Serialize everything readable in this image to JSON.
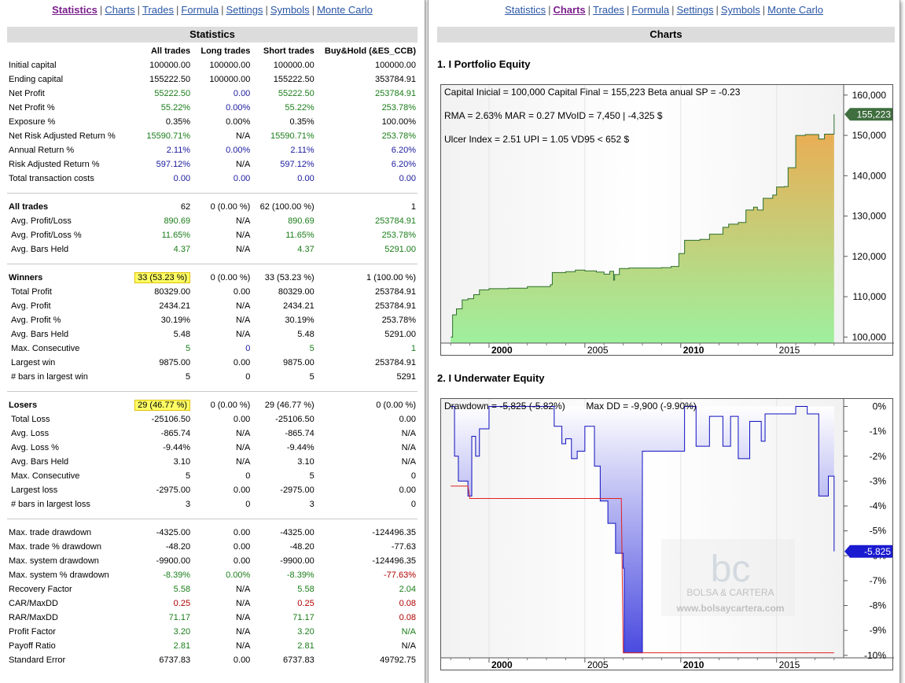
{
  "nav": {
    "items": [
      "Statistics",
      "Charts",
      "Trades",
      "Formula",
      "Settings",
      "Symbols",
      "Monte Carlo"
    ],
    "separator": "|"
  },
  "stats": {
    "title": "Statistics",
    "columns": [
      "All trades",
      "Long trades",
      "Short trades",
      "Buy&Hold (&ES_CCB)"
    ],
    "rows": [
      {
        "label": "Initial capital",
        "values": [
          "100000.00",
          "100000.00",
          "100000.00",
          "100000.00"
        ],
        "colors": [
          "",
          "",
          "",
          ""
        ]
      },
      {
        "label": "Ending capital",
        "values": [
          "155222.50",
          "100000.00",
          "155222.50",
          "353784.91"
        ],
        "colors": [
          "",
          "",
          "",
          ""
        ]
      },
      {
        "label": "Net Profit",
        "values": [
          "55222.50",
          "0.00",
          "55222.50",
          "253784.91"
        ],
        "colors": [
          "green",
          "blue",
          "green",
          "green"
        ]
      },
      {
        "label": "Net Profit %",
        "values": [
          "55.22%",
          "0.00%",
          "55.22%",
          "253.78%"
        ],
        "colors": [
          "green",
          "blue",
          "green",
          "green"
        ]
      },
      {
        "label": "Exposure %",
        "values": [
          "0.35%",
          "0.00%",
          "0.35%",
          "100.00%"
        ],
        "colors": [
          "",
          "",
          "",
          ""
        ]
      },
      {
        "label": "Net Risk Adjusted Return %",
        "values": [
          "15590.71%",
          "N/A",
          "15590.71%",
          "253.78%"
        ],
        "colors": [
          "green",
          "",
          "green",
          "green"
        ]
      },
      {
        "label": "Annual Return %",
        "values": [
          "2.11%",
          "0.00%",
          "2.11%",
          "6.20%"
        ],
        "colors": [
          "blue",
          "blue",
          "blue",
          "blue"
        ]
      },
      {
        "label": "Risk Adjusted Return %",
        "values": [
          "597.12%",
          "N/A",
          "597.12%",
          "6.20%"
        ],
        "colors": [
          "blue",
          "",
          "blue",
          "blue"
        ]
      },
      {
        "label": "Total transaction costs",
        "values": [
          "0.00",
          "0.00",
          "0.00",
          "0.00"
        ],
        "colors": [
          "blue",
          "blue",
          "blue",
          "blue"
        ]
      },
      {
        "separator": true
      },
      {
        "label": "All trades",
        "bold": true,
        "values": [
          "62",
          "0 (0.00 %)",
          "62 (100.00 %)",
          "1"
        ],
        "colors": [
          "",
          "",
          "",
          ""
        ]
      },
      {
        "label": "Avg. Profit/Loss",
        "sub": true,
        "values": [
          "890.69",
          "N/A",
          "890.69",
          "253784.91"
        ],
        "colors": [
          "green",
          "",
          "green",
          "green"
        ]
      },
      {
        "label": "Avg. Profit/Loss %",
        "sub": true,
        "values": [
          "11.65%",
          "N/A",
          "11.65%",
          "253.78%"
        ],
        "colors": [
          "green",
          "",
          "green",
          "green"
        ]
      },
      {
        "label": "Avg. Bars Held",
        "sub": true,
        "values": [
          "4.37",
          "N/A",
          "4.37",
          "5291.00"
        ],
        "colors": [
          "green",
          "",
          "green",
          "green"
        ]
      },
      {
        "separator": true
      },
      {
        "label": "Winners",
        "bold": true,
        "highlight": true,
        "values": [
          "33 (53.23 %)",
          "0 (0.00 %)",
          "33 (53.23 %)",
          "1 (100.00 %)"
        ],
        "colors": [
          "",
          "",
          "",
          ""
        ]
      },
      {
        "label": "Total Profit",
        "sub": true,
        "values": [
          "80329.00",
          "0.00",
          "80329.00",
          "253784.91"
        ],
        "colors": [
          "",
          "",
          "",
          ""
        ]
      },
      {
        "label": "Avg. Profit",
        "sub": true,
        "values": [
          "2434.21",
          "N/A",
          "2434.21",
          "253784.91"
        ],
        "colors": [
          "",
          "",
          "",
          ""
        ]
      },
      {
        "label": "Avg. Profit %",
        "sub": true,
        "values": [
          "30.19%",
          "N/A",
          "30.19%",
          "253.78%"
        ],
        "colors": [
          "",
          "",
          "",
          ""
        ]
      },
      {
        "label": "Avg. Bars Held",
        "sub": true,
        "values": [
          "5.48",
          "N/A",
          "5.48",
          "5291.00"
        ],
        "colors": [
          "",
          "",
          "",
          ""
        ]
      },
      {
        "label": "Max. Consecutive",
        "sub": true,
        "values": [
          "5",
          "0",
          "5",
          "1"
        ],
        "colors": [
          "green",
          "blue",
          "green",
          "green"
        ]
      },
      {
        "label": "Largest win",
        "sub": true,
        "values": [
          "9875.00",
          "0.00",
          "9875.00",
          "253784.91"
        ],
        "colors": [
          "",
          "",
          "",
          ""
        ]
      },
      {
        "label": "# bars in largest win",
        "sub": true,
        "values": [
          "5",
          "0",
          "5",
          "5291"
        ],
        "colors": [
          "",
          "",
          "",
          ""
        ]
      },
      {
        "separator": true
      },
      {
        "label": "Losers",
        "bold": true,
        "highlight": true,
        "values": [
          "29 (46.77 %)",
          "0 (0.00 %)",
          "29 (46.77 %)",
          "0 (0.00 %)"
        ],
        "colors": [
          "",
          "",
          "",
          ""
        ]
      },
      {
        "label": "Total Loss",
        "sub": true,
        "values": [
          "-25106.50",
          "0.00",
          "-25106.50",
          "0.00"
        ],
        "colors": [
          "",
          "",
          "",
          ""
        ]
      },
      {
        "label": "Avg. Loss",
        "sub": true,
        "values": [
          "-865.74",
          "N/A",
          "-865.74",
          "N/A"
        ],
        "colors": [
          "",
          "",
          "",
          ""
        ]
      },
      {
        "label": "Avg. Loss %",
        "sub": true,
        "values": [
          "-9.44%",
          "N/A",
          "-9.44%",
          "N/A"
        ],
        "colors": [
          "",
          "",
          "",
          ""
        ]
      },
      {
        "label": "Avg. Bars Held",
        "sub": true,
        "values": [
          "3.10",
          "N/A",
          "3.10",
          "N/A"
        ],
        "colors": [
          "",
          "",
          "",
          ""
        ]
      },
      {
        "label": "Max. Consecutive",
        "sub": true,
        "values": [
          "5",
          "0",
          "5",
          "0"
        ],
        "colors": [
          "",
          "",
          "",
          ""
        ]
      },
      {
        "label": "Largest loss",
        "sub": true,
        "values": [
          "-2975.00",
          "0.00",
          "-2975.00",
          "0.00"
        ],
        "colors": [
          "",
          "",
          "",
          ""
        ]
      },
      {
        "label": "# bars in largest loss",
        "sub": true,
        "values": [
          "3",
          "0",
          "3",
          "0"
        ],
        "colors": [
          "",
          "",
          "",
          ""
        ]
      },
      {
        "separator": true
      },
      {
        "label": "Max. trade drawdown",
        "values": [
          "-4325.00",
          "0.00",
          "-4325.00",
          "-124496.35"
        ],
        "colors": [
          "",
          "",
          "",
          ""
        ]
      },
      {
        "label": "Max. trade % drawdown",
        "values": [
          "-48.20",
          "0.00",
          "-48.20",
          "-77.63"
        ],
        "colors": [
          "",
          "",
          "",
          ""
        ]
      },
      {
        "label": "Max. system drawdown",
        "values": [
          "-9900.00",
          "0.00",
          "-9900.00",
          "-124496.35"
        ],
        "colors": [
          "",
          "",
          "",
          ""
        ]
      },
      {
        "label": "Max. system % drawdown",
        "values": [
          "-8.39%",
          "0.00%",
          "-8.39%",
          "-77.63%"
        ],
        "colors": [
          "green",
          "green",
          "green",
          "red"
        ]
      },
      {
        "label": "Recovery Factor",
        "values": [
          "5.58",
          "N/A",
          "5.58",
          "2.04"
        ],
        "colors": [
          "green",
          "",
          "green",
          "green"
        ]
      },
      {
        "label": "CAR/MaxDD",
        "values": [
          "0.25",
          "N/A",
          "0.25",
          "0.08"
        ],
        "colors": [
          "red",
          "",
          "red",
          "red"
        ]
      },
      {
        "label": "RAR/MaxDD",
        "values": [
          "71.17",
          "N/A",
          "71.17",
          "0.08"
        ],
        "colors": [
          "green",
          "",
          "green",
          "red"
        ]
      },
      {
        "label": "Profit Factor",
        "values": [
          "3.20",
          "N/A",
          "3.20",
          "N/A"
        ],
        "colors": [
          "green",
          "",
          "green",
          "green"
        ]
      },
      {
        "label": "Payoff Ratio",
        "values": [
          "2.81",
          "N/A",
          "2.81",
          "N/A"
        ],
        "colors": [
          "green",
          "",
          "green",
          ""
        ]
      },
      {
        "label": "Standard Error",
        "values": [
          "6737.83",
          "0.00",
          "6737.83",
          "49792.75"
        ],
        "colors": [
          "",
          "",
          "",
          ""
        ]
      }
    ]
  },
  "charts_panel": {
    "title": "Charts",
    "equity_title": "1. I Portfolio Equity",
    "equity_info": [
      "Capital Inicial = 100,000  Capital Final = 155,223  Beta anual SP = -0.23",
      "RMA = 2.63%   MAR = 0.27   MVoID = 7,450 | -4,325 $",
      "Ulcer Index = 2.51   UPI = 1.05   VD95 < 652 $"
    ],
    "equity_last_label": "155,223",
    "underwater_title": "2. I Underwater Equity",
    "underwater_info": "Drawdown = -5,825 (-5.82%)        Max DD = -9,900 (-9.90%)",
    "underwater_last_label": "-5.825",
    "watermark_logo": "bc",
    "watermark_name": "BOLSA & CARTERA",
    "watermark_url": "www.bolsaycartera.com"
  },
  "chart_data": [
    {
      "type": "area",
      "title": "1. I Portfolio Equity",
      "xlabel": "",
      "ylabel": "",
      "x_ticks": [
        "2000",
        "2005",
        "2010",
        "2015"
      ],
      "y_ticks": [
        "100,000",
        "110,000",
        "120,000",
        "130,000",
        "140,000",
        "150,000",
        "160,000"
      ],
      "xlim": [
        1997.5,
        2018.5
      ],
      "ylim": [
        98500,
        162500
      ],
      "last_value": 155223,
      "fill_colors": [
        "#9ef09e",
        "#f0a84e"
      ],
      "line_color": "#2d6e2d",
      "grid": true,
      "series": [
        {
          "x": [
            1998.0,
            1998.1,
            1998.3,
            1998.6,
            1998.9,
            1999.2,
            1999.5,
            2000.0,
            2001.0,
            2002.0,
            2003.2,
            2003.3,
            2004.0,
            2004.5,
            2005.0,
            2005.6,
            2006.0,
            2006.3,
            2006.5,
            2006.55,
            2006.8,
            2007.3,
            2008.0,
            2009.0,
            2009.5,
            2009.9,
            2010.2,
            2011.0,
            2011.5,
            2012.2,
            2012.5,
            2013.0,
            2013.4,
            2013.8,
            2014.0,
            2014.3,
            2014.8,
            2015.0,
            2015.4,
            2015.6,
            2016.0,
            2016.5,
            2017.2,
            2017.5,
            2018.0
          ],
          "y": [
            100000,
            105500,
            107000,
            109200,
            109500,
            110500,
            111700,
            112000,
            112100,
            112500,
            113000,
            116000,
            116200,
            116600,
            116400,
            116100,
            115600,
            116300,
            114100,
            115500,
            117000,
            117100,
            117100,
            117200,
            117500,
            120700,
            124000,
            124200,
            125500,
            127200,
            128000,
            128400,
            131500,
            132200,
            131500,
            134400,
            135200,
            137200,
            137300,
            142000,
            150000,
            150200,
            149100,
            150300,
            155223
          ]
        }
      ]
    },
    {
      "type": "area",
      "title": "2. I Underwater Equity",
      "xlabel": "",
      "ylabel": "",
      "x_ticks": [
        "2000",
        "2005",
        "2010",
        "2015"
      ],
      "y_ticks": [
        "0%",
        "-1%",
        "-2%",
        "-3%",
        "-4%",
        "-5%",
        "-6%",
        "-7%",
        "-8%",
        "-9%",
        "-10%"
      ],
      "xlim": [
        1997.5,
        2018.5
      ],
      "ylim": [
        -10.1,
        0.3
      ],
      "last_value": -5.825,
      "fill_color": "#4a4ae0",
      "max_dd_line_color": "#e02020",
      "grid": true,
      "series": [
        {
          "name": "Drawdown %",
          "x": [
            1998.0,
            1998.2,
            1998.4,
            1998.9,
            1999.1,
            1999.3,
            1999.5,
            2000.0,
            2002.0,
            2003.2,
            2003.4,
            2003.8,
            2004.0,
            2004.3,
            2004.6,
            2005.0,
            2005.5,
            2005.8,
            2006.2,
            2006.6,
            2007.0,
            2007.05,
            2008.0,
            2010.0,
            2010.2,
            2010.8,
            2011.5,
            2012.2,
            2012.6,
            2013.0,
            2013.6,
            2014.2,
            2014.4,
            2015.0,
            2015.5,
            2016.0,
            2016.6,
            2017.2,
            2017.7,
            2018.0
          ],
          "y": [
            0,
            -2.0,
            -3.0,
            -3.6,
            -1.2,
            -2.0,
            -0.9,
            0,
            0,
            0,
            -0.8,
            -1.5,
            -1.3,
            -2.1,
            -1.8,
            -0.8,
            -2.4,
            -3.8,
            -4.7,
            -5.9,
            -6.5,
            -9.9,
            -1.8,
            -1.8,
            0,
            -1.6,
            -0.4,
            -1.6,
            -0.4,
            -2.1,
            -0.6,
            -1.4,
            -0.3,
            -0.3,
            -0.3,
            0,
            -0.3,
            -3.6,
            -2.8,
            -5.825
          ]
        },
        {
          "name": "Max DD",
          "x": [
            1998.0,
            1998.9,
            1999.0,
            2006.9,
            2007.0,
            2018.0
          ],
          "y": [
            -3.2,
            -3.2,
            -3.7,
            -3.7,
            -9.9,
            -9.9
          ]
        }
      ]
    }
  ]
}
